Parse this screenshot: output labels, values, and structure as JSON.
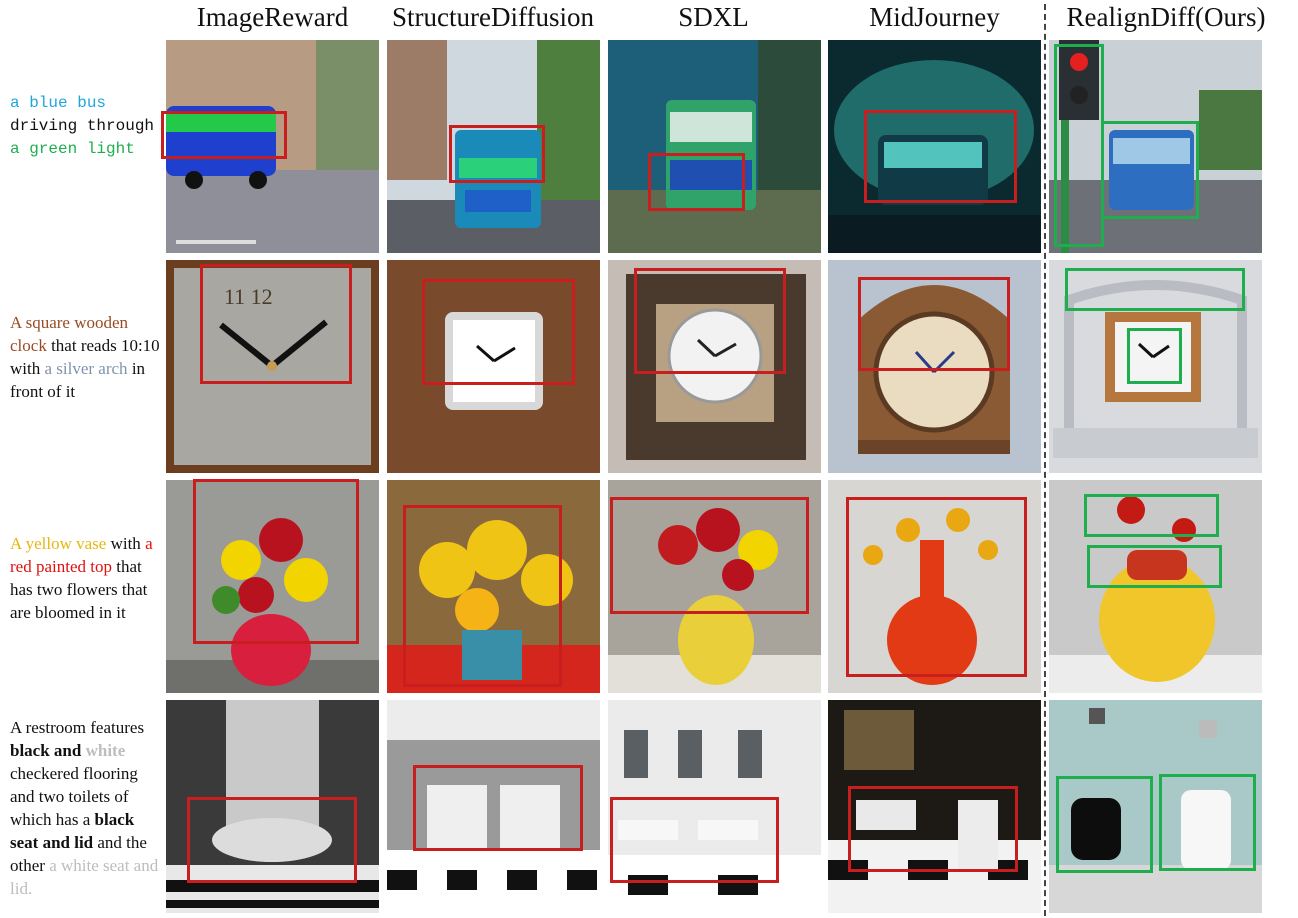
{
  "columns": [
    "ImageReward",
    "StructureDiffusion",
    "SDXL",
    "MidJourney",
    "RealignDiff(Ours)"
  ],
  "prompts": [
    {
      "segments": [
        {
          "text": "a blue bus",
          "color": "#1ea6dc",
          "bold": false,
          "br": true
        },
        {
          "text": "driving through",
          "color": "#111111",
          "bold": false,
          "br": true
        },
        {
          "text": "a green light",
          "color": "#1fae4d",
          "bold": false,
          "br": false
        }
      ]
    },
    {
      "segments": [
        {
          "text": "A square wooden clock",
          "color": "#9a4a22",
          "bold": false
        },
        {
          "text": " that reads 10:10 with ",
          "color": "#111111",
          "bold": false
        },
        {
          "text": "a silver arch",
          "color": "#7f93ad",
          "bold": false
        },
        {
          "text": " in front of it",
          "color": "#111111",
          "bold": false
        }
      ]
    },
    {
      "segments": [
        {
          "text": "A yellow vase",
          "color": "#e6b711",
          "bold": false
        },
        {
          "text": " with ",
          "color": "#111111",
          "bold": false
        },
        {
          "text": "a red painted top",
          "color": "#e01010",
          "bold": false
        },
        {
          "text": " that has two flowers that are bloomed in it",
          "color": "#111111",
          "bold": false
        }
      ]
    },
    {
      "segments": [
        {
          "text": "A restroom features ",
          "color": "#111111",
          "bold": false
        },
        {
          "text": "black and",
          "color": "#111111",
          "bold": true
        },
        {
          "text": " white",
          "color": "#bdbdbd",
          "bold": true
        },
        {
          "text": " checkered flooring and two toilets of which has a ",
          "color": "#111111",
          "bold": false
        },
        {
          "text": "black seat and lid",
          "color": "#111111",
          "bold": true
        },
        {
          "text": " and the other ",
          "color": "#111111",
          "bold": false
        },
        {
          "text": "a white seat and lid.",
          "color": "#bdbdbd",
          "bold": false
        }
      ]
    }
  ],
  "colors": {
    "baseline_box": "#c91e1e",
    "ours_box": "#1fae4d"
  }
}
